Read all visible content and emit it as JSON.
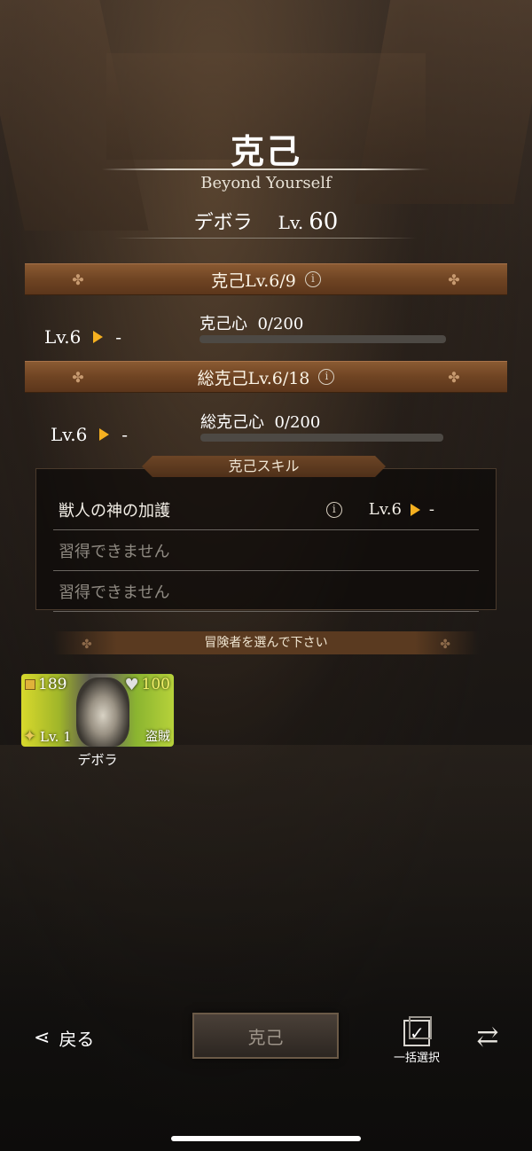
{
  "header": {
    "title": "克己",
    "subtitle": "Beyond Yourself",
    "character_name": "デボラ",
    "level_prefix": "Lv.",
    "level": "60"
  },
  "overcome": {
    "banner": "克己Lv.6/9",
    "current_level": "Lv.6",
    "next_level": "-",
    "stat_label": "克己心",
    "stat_value": "0/200",
    "progress": 0
  },
  "total_overcome": {
    "banner": "総克己Lv.6/18",
    "current_level": "Lv.6",
    "next_level": "-",
    "stat_label": "総克己心",
    "stat_value": "0/200",
    "progress": 0
  },
  "skills": {
    "header": "克己スキル",
    "items": [
      {
        "name": "獣人の神の加護",
        "current_level": "Lv.6",
        "next_level": "-"
      },
      {
        "name": "習得できません"
      },
      {
        "name": "習得できません"
      }
    ]
  },
  "select_prompt": "冒険者を選んで下さい",
  "adventurer_card": {
    "attack": "189",
    "hp": "100",
    "level": "Lv. 1",
    "job": "盗賊",
    "name": "デボラ"
  },
  "footer": {
    "back_label": "戻る",
    "confirm_label": "克己",
    "bulk_select_label": "一括選択"
  },
  "icons": {
    "info": "info-icon",
    "arrow": "arrow-right-icon",
    "back": "back-arrow-icon",
    "bulk_select": "checkbox-stack-icon",
    "swap": "swap-icon"
  },
  "colors": {
    "banner": "#6f4423",
    "arrow": "#f5b020",
    "progress_track": "#4d4944"
  }
}
